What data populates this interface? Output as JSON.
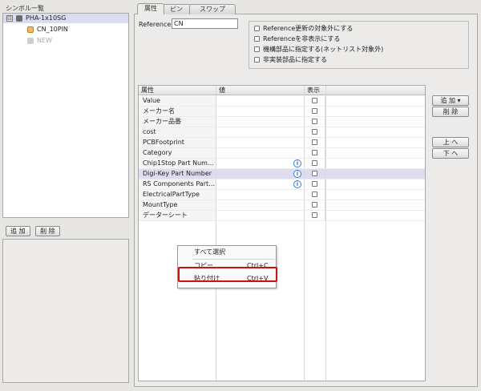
{
  "left_panel": {
    "title": "シンボル一覧",
    "tree": [
      {
        "label": "PHA-1x10SG",
        "expander": "⊟"
      },
      {
        "label": "CN_10PIN"
      },
      {
        "label": "NEW"
      }
    ],
    "add_label": "追 加",
    "delete_label": "削 除"
  },
  "tabs": [
    {
      "label": "属性",
      "active": true
    },
    {
      "label": "ピン"
    },
    {
      "label": "スワップ"
    }
  ],
  "reference": {
    "label": "Reference",
    "value": "CN"
  },
  "options": [
    "Reference更新の対象外にする",
    "Referenceを非表示にする",
    "機構部品に指定する(ネットリスト対象外)",
    "非実装部品に指定する"
  ],
  "grid": {
    "headers": {
      "attr": "属性",
      "value": "値",
      "show": "表示"
    },
    "rows": [
      {
        "name": "Value",
        "info": false
      },
      {
        "name": "メーカー名",
        "info": false
      },
      {
        "name": "メーカー品番",
        "info": false
      },
      {
        "name": "cost",
        "info": false
      },
      {
        "name": "PCBFootprint",
        "info": false
      },
      {
        "name": "Category",
        "info": false
      },
      {
        "name": "Chip1Stop Part Num…",
        "info": true
      },
      {
        "name": "Digi-Key Part Number",
        "info": true,
        "selected": true
      },
      {
        "name": "RS Components Part…",
        "info": true
      },
      {
        "name": "ElectricalPartType",
        "info": false
      },
      {
        "name": "MountType",
        "info": false
      },
      {
        "name": "データーシート",
        "info": false
      }
    ],
    "info_glyph": "i"
  },
  "right_buttons": {
    "add_label": "追 加 ▾",
    "delete_label": "削 除",
    "up_label": "上 へ",
    "down_label": "下 へ"
  },
  "context_menu": {
    "items": [
      {
        "label": "すべて選択",
        "shortcut": ""
      },
      {
        "label": "コピー",
        "shortcut": "Ctrl+C"
      },
      {
        "label": "貼り付け",
        "shortcut": "Ctrl+V",
        "highlighted": true
      }
    ]
  },
  "colors": {
    "highlight_border": "#cc1111",
    "selected_row": "#dedcef",
    "info_icon": "#3a7bd5"
  }
}
